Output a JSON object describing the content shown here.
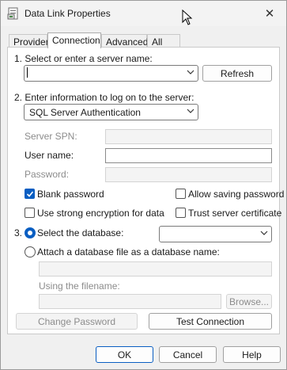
{
  "window": {
    "title": "Data Link Properties",
    "close_label": "✕"
  },
  "tabs": [
    {
      "label": "Provider"
    },
    {
      "label": "Connection"
    },
    {
      "label": "Advanced"
    },
    {
      "label": "All"
    }
  ],
  "server": {
    "section_label": "1. Select or enter a server name:",
    "value": "",
    "refresh_label": "Refresh"
  },
  "logon": {
    "section_label": "2. Enter information to log on to the server:",
    "auth_selected": "SQL Server Authentication",
    "spn_label": "Server SPN:",
    "username_label": "User name:",
    "username_value": "",
    "password_label": "Password:",
    "blank_password_label": "Blank password",
    "blank_password_checked": true,
    "allow_saving_label": "Allow saving password",
    "allow_saving_checked": false,
    "strong_encryption_label": "Use strong encryption for data",
    "strong_encryption_checked": false,
    "trust_cert_label": "Trust server certificate",
    "trust_cert_checked": false
  },
  "database": {
    "section_number": "3.",
    "select_db_label": "Select the database:",
    "select_db_selected": true,
    "db_value": "",
    "attach_label": "Attach a database file as a database name:",
    "attach_value": "",
    "filename_label": "Using the filename:",
    "filename_value": "",
    "browse_label": "Browse..."
  },
  "actions": {
    "change_password_label": "Change Password",
    "test_connection_label": "Test Connection"
  },
  "footer": {
    "ok_label": "OK",
    "cancel_label": "Cancel",
    "help_label": "Help"
  },
  "colors": {
    "accent": "#0a5ec2",
    "disabled_text": "#8c8c8c"
  }
}
